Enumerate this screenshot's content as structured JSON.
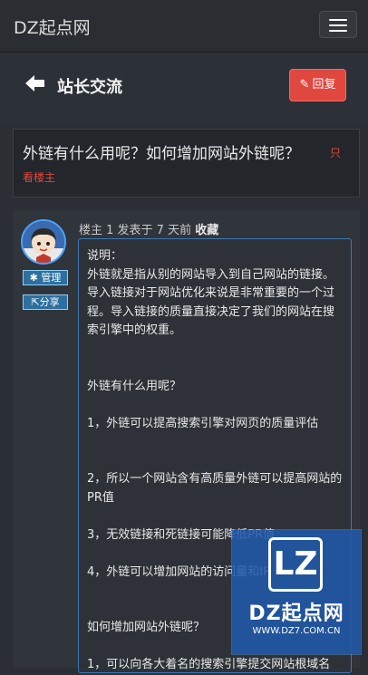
{
  "navbar": {
    "brand": "DZ起点网",
    "menu_icon": "hamburger-icon"
  },
  "header": {
    "title": "站长交流",
    "back_icon": "arrow-left-icon",
    "reply_label": "回复",
    "reply_icon": "pencil-icon"
  },
  "thread": {
    "title": "外链有什么用呢？如何增加网站外链呢？",
    "flag_label": "只",
    "op_only_label": "看楼主"
  },
  "sidebar": {
    "manage_label": "管理",
    "manage_icon": "gear-icon",
    "share_label": "分享",
    "share_icon": "share-icon"
  },
  "post": {
    "meta": "楼主 1 发表于 7 天前",
    "favorite_label": "收藏",
    "lines": [
      "说明：\n外链就是指从别的网站导入到自己网站的链接。导入链接对于网站优化来说是非常重要的一个过程。导入链接的质量直接决定了我们的网站在搜索引擎中的权重。",
      "",
      "",
      "外链有什么用呢？",
      "",
      "1，外链可以提高搜索引擎对网页的质量评估",
      "",
      "",
      "2，所以一个网站含有高质量外链可以提高网站的PR值",
      "",
      "3，无效链接和死链接可能降低PR值",
      "",
      "4，外链可以增加网站的访问量和IP",
      "",
      "",
      "如何增加网站外链呢？",
      "",
      "1，可以向各大着名的搜索引擎提交网站根域名"
    ]
  },
  "watermark": {
    "logo_text": "LZ",
    "name": "DZ起点网",
    "url": "WWW.DZ7.COM.CN"
  },
  "colors": {
    "accent_red": "#e0473f",
    "link_blue": "#4aa3ff",
    "background": "#2b2f35"
  }
}
